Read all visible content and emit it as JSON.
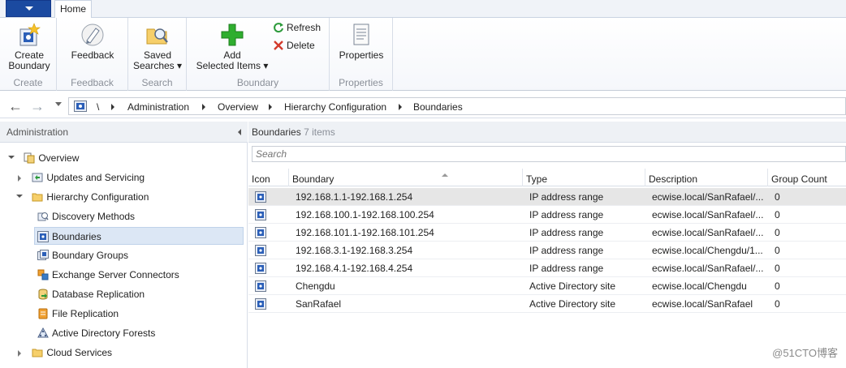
{
  "ribbon": {
    "tab_home": "Home",
    "groups": [
      {
        "label": "Create"
      },
      {
        "label": "Feedback"
      },
      {
        "label": "Search"
      },
      {
        "label": "Boundary"
      },
      {
        "label": "Properties"
      }
    ],
    "buttons": {
      "create_boundary": {
        "line1": "Create",
        "line2": "Boundary",
        "icon": "create-boundary-icon"
      },
      "feedback": {
        "line1": "Feedback",
        "icon": "feedback-pen-icon"
      },
      "saved_searches": {
        "line1": "Saved",
        "line2": "Searches ▾",
        "icon": "saved-searches-folder-icon"
      },
      "add_selected": {
        "line1": "Add",
        "line2": "Selected Items ▾",
        "icon": "green-plus-icon"
      },
      "refresh": {
        "label": "Refresh",
        "icon": "refresh-icon"
      },
      "delete": {
        "label": "Delete",
        "icon": "delete-x-icon"
      },
      "properties": {
        "line1": "Properties",
        "icon": "properties-icon"
      }
    }
  },
  "address": {
    "root": "\\",
    "crumbs": [
      "Administration",
      "Overview",
      "Hierarchy Configuration",
      "Boundaries"
    ]
  },
  "nav": {
    "title": "Administration",
    "items": [
      {
        "label": "Overview"
      },
      {
        "label": "Updates and Servicing"
      },
      {
        "label": "Hierarchy Configuration"
      },
      {
        "label": "Discovery Methods"
      },
      {
        "label": "Boundaries"
      },
      {
        "label": "Boundary Groups"
      },
      {
        "label": "Exchange Server Connectors"
      },
      {
        "label": "Database Replication"
      },
      {
        "label": "File Replication"
      },
      {
        "label": "Active Directory Forests"
      },
      {
        "label": "Cloud Services"
      }
    ]
  },
  "content": {
    "title": "Boundaries",
    "count": "7 items",
    "search_placeholder": "Search",
    "columns": [
      "Icon",
      "Boundary",
      "Type",
      "Description",
      "Group Count"
    ],
    "rows": [
      {
        "boundary": "192.168.1.1-192.168.1.254",
        "type": "IP address range",
        "description": "ecwise.local/SanRafael/...",
        "group_count": "0"
      },
      {
        "boundary": "192.168.100.1-192.168.100.254",
        "type": "IP address range",
        "description": "ecwise.local/SanRafael/...",
        "group_count": "0"
      },
      {
        "boundary": "192.168.101.1-192.168.101.254",
        "type": "IP address range",
        "description": "ecwise.local/SanRafael/...",
        "group_count": "0"
      },
      {
        "boundary": "192.168.3.1-192.168.3.254",
        "type": "IP address range",
        "description": "ecwise.local/Chengdu/1...",
        "group_count": "0"
      },
      {
        "boundary": "192.168.4.1-192.168.4.254",
        "type": "IP address range",
        "description": "ecwise.local/SanRafael/...",
        "group_count": "0"
      },
      {
        "boundary": "Chengdu",
        "type": "Active Directory site",
        "description": "ecwise.local/Chengdu",
        "group_count": "0"
      },
      {
        "boundary": "SanRafael",
        "type": "Active Directory site",
        "description": "ecwise.local/SanRafael",
        "group_count": "0"
      }
    ]
  },
  "watermark": "@51CTO博客",
  "colors": {
    "app_button": "#1b4aa0",
    "selection": "#dce7f5",
    "green_plus": "#2fae2f"
  }
}
